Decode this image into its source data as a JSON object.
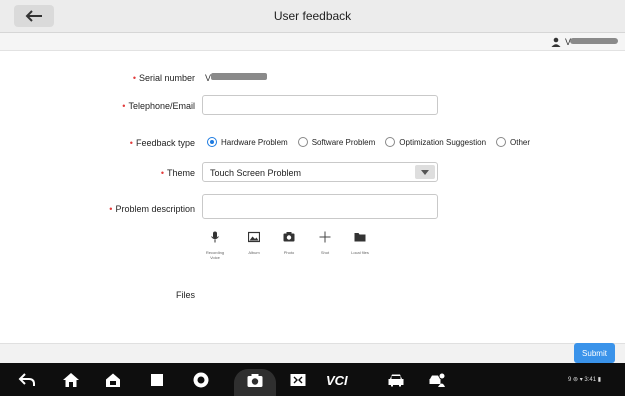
{
  "header": {
    "title": "User feedback"
  },
  "user": {
    "name": "V"
  },
  "form": {
    "serial": {
      "label": "Serial number",
      "value": "V"
    },
    "contact": {
      "label": "Telephone/Email",
      "value": ""
    },
    "feedback_type": {
      "label": "Feedback type",
      "options": [
        "Hardware Problem",
        "Software Problem",
        "Optimization Suggestion",
        "Other"
      ],
      "selected": "Hardware Problem"
    },
    "theme": {
      "label": "Theme",
      "value": "Touch Screen Problem"
    },
    "description": {
      "label": "Problem description",
      "value": ""
    },
    "attachments": {
      "items": [
        {
          "icon": "microphone-icon",
          "label": "Recording Voice"
        },
        {
          "icon": "image-icon",
          "label": "Album"
        },
        {
          "icon": "camera-icon",
          "label": "Photo"
        },
        {
          "icon": "plus-icon",
          "label": "Shot"
        },
        {
          "icon": "folder-icon",
          "label": "Local files"
        }
      ]
    },
    "files": {
      "label": "Files"
    }
  },
  "actions": {
    "submit": "Submit"
  },
  "status_bar": {
    "text": "9 ⊚ ▾ 3:41 ▮"
  },
  "colors": {
    "accent": "#1e7be0",
    "submit": "#3a93ea",
    "required": "#e23b3b",
    "navbar": "#0e0e0e"
  }
}
